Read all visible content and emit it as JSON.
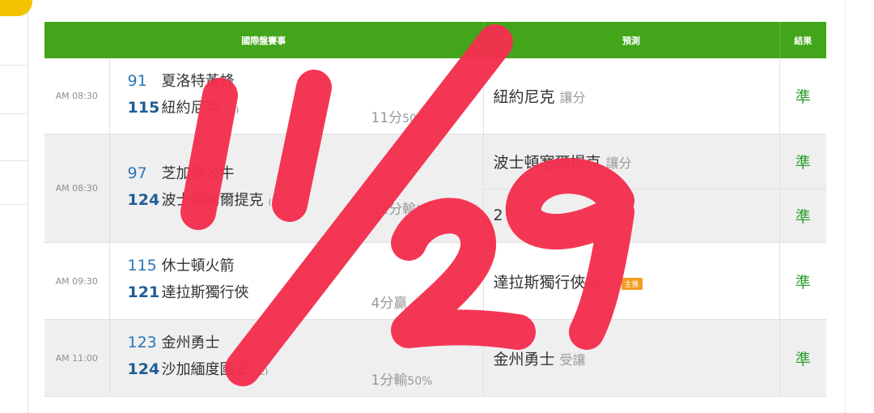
{
  "header": {
    "col_event": "國際盤賽事",
    "col_prediction": "預測",
    "col_result": "結果"
  },
  "games": [
    {
      "time": "AM 08:30",
      "away_score": "91",
      "away_team": "夏洛特黃蜂",
      "home_score": "115",
      "home_team": "紐約尼克",
      "home_tag": "(主)",
      "line": "11分",
      "line_pct": "50%",
      "predictions": [
        {
          "team": "紐約尼克",
          "type": "讓分",
          "result": "準"
        }
      ]
    },
    {
      "time": "AM 08:30",
      "away_score": "97",
      "away_team": "芝加哥公牛",
      "home_score": "124",
      "home_team": "波士頓塞爾提克",
      "home_tag": "(主)",
      "line": "12分輸",
      "line_pct": "50%",
      "predictions": [
        {
          "team": "波士頓塞爾提克",
          "type": "讓分",
          "result": "準"
        },
        {
          "team": "2",
          "type": "",
          "result": "準"
        }
      ]
    },
    {
      "time": "AM 09:30",
      "away_score": "115",
      "away_team": "休士頓火箭",
      "home_score": "121",
      "home_team": "達拉斯獨行俠",
      "home_tag": "",
      "line": "4分贏",
      "line_pct": "",
      "predictions": [
        {
          "team": "達拉斯獨行俠",
          "type": "讓分",
          "tag": "主推",
          "result": "準"
        }
      ]
    },
    {
      "time": "AM 11:00",
      "away_score": "123",
      "away_team": "金州勇士",
      "home_score": "124",
      "home_team": "沙加緬度國王",
      "home_tag": "(主)",
      "line": "1分輸",
      "line_pct": "50%",
      "predictions": [
        {
          "team": "金州勇士",
          "type": "受讓",
          "result": "準"
        }
      ]
    }
  ],
  "overlay": {
    "handwritten_text": "11/29",
    "color": "#f4304f"
  }
}
